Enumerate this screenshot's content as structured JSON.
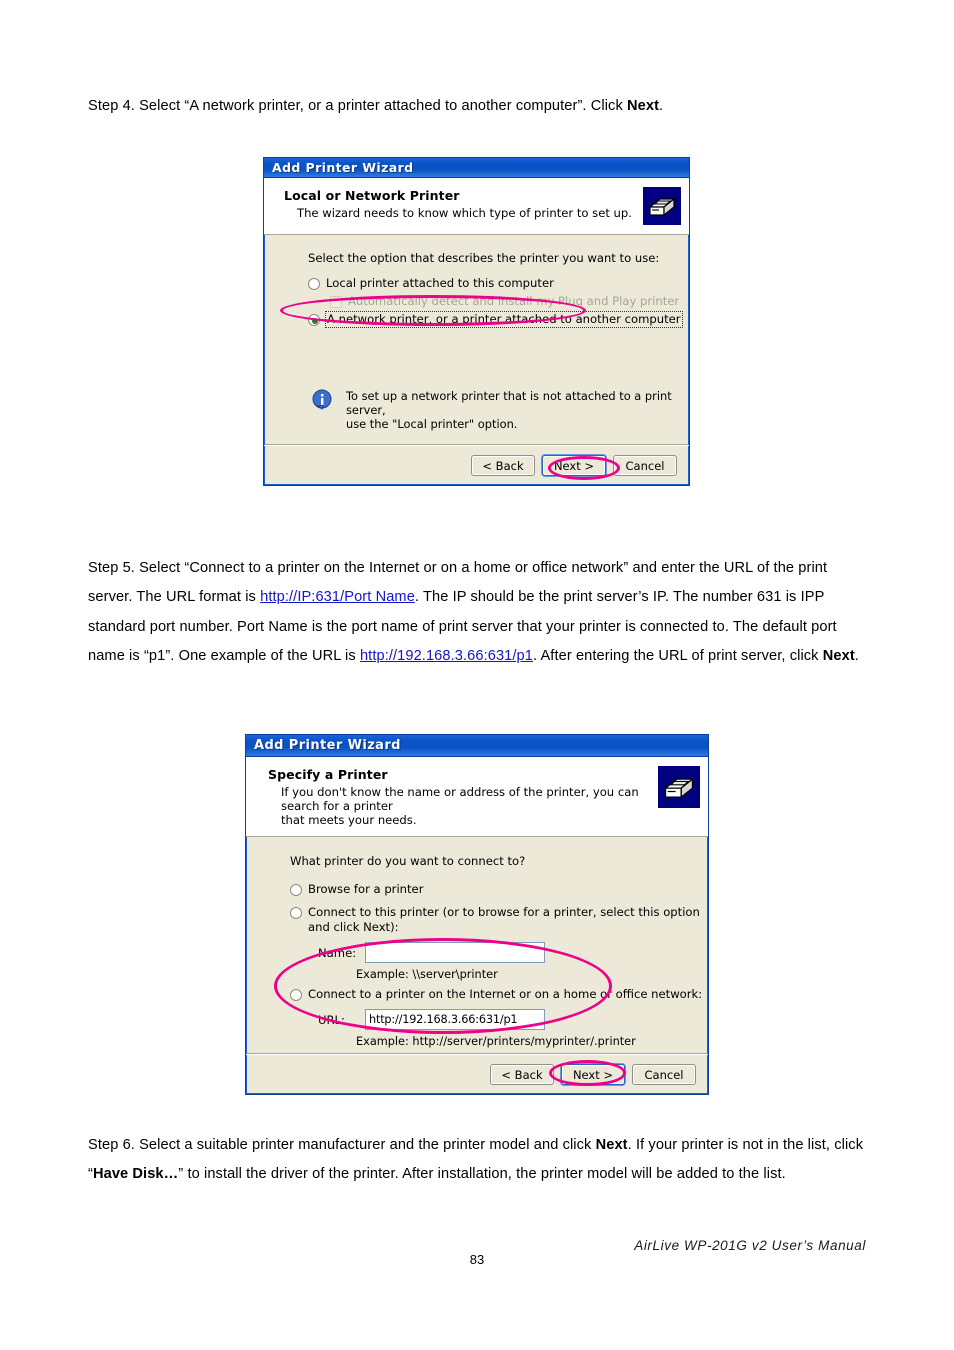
{
  "document": {
    "step4": {
      "prefix": "Step 4. Select “A network printer, or a printer attached to another computer”. Click ",
      "bold": "Next",
      "suffix": "."
    },
    "step5": {
      "part1": "Step 5. Select “Connect to a printer on the Internet or on a home or office network” and enter the URL of the print server. The URL format is ",
      "link1": "http://IP:631/Port Name",
      "part2": ". The IP should be the print server’s IP. The number 631 is IPP standard port number. Port Name is the port name of print server that your printer is connected to. The default port name is “p1”. One example of the URL is ",
      "link2": "http://192.168.3.66:631/p1",
      "part3": ". After entering the URL of print server, click ",
      "bold": "Next",
      "part4": "."
    },
    "step6": {
      "part1": "Step 6. Select a suitable printer manufacturer and the printer model and click ",
      "bold1": "Next",
      "part2": ". If your printer is not in the list, click “",
      "bold2": "Have Disk…",
      "part3": "” to install the driver of the printer. After installation, the printer model will be added to the list."
    },
    "footer": {
      "page_number": "83",
      "manual": "AirLive WP-201G v2 User’s Manual"
    }
  },
  "dialog1": {
    "title": "Add Printer Wizard",
    "header_title": "Local or Network Printer",
    "header_sub": "The wizard needs to know which type of printer to set up.",
    "icon": "printer-icon",
    "prompt": "Select the option that describes the printer you want to use:",
    "options": [
      {
        "label": "Local printer attached to this computer",
        "checked": false
      },
      {
        "label": "A network printer, or a printer attached to another computer",
        "checked": true
      }
    ],
    "checkbox": {
      "label": "Automatically detect and install my Plug and Play printer",
      "checked": false,
      "disabled": true
    },
    "info": {
      "icon": "info-icon",
      "line1": "To set up a network printer that is not attached to a print server,",
      "line2": "use the \"Local printer\" option."
    },
    "buttons": {
      "back": "< Back",
      "next": "Next >",
      "cancel": "Cancel"
    },
    "highlight_color": "#ec008c"
  },
  "dialog2": {
    "title": "Add Printer Wizard",
    "header_title": "Specify a Printer",
    "header_sub_line1": "If you don't know the name or address of the printer, you can search for a printer",
    "header_sub_line2": "that meets your needs.",
    "icon": "printer-icon",
    "prompt": "What printer do you want to connect to?",
    "option_browse": "Browse for a printer",
    "option_connect": "Connect to this printer (or to browse for a printer, select this option and click Next):",
    "name_label": "Name:",
    "name_value": "",
    "name_example": "Example: \\\\server\\printer",
    "option_internet": "Connect to a printer on the Internet or on a home or office network:",
    "url_label": "URL:",
    "url_value": "http://192.168.3.66:631/p1",
    "url_example": "Example: http://server/printers/myprinter/.printer",
    "buttons": {
      "back": "< Back",
      "next": "Next >",
      "cancel": "Cancel"
    },
    "highlight_color": "#ec008c"
  }
}
